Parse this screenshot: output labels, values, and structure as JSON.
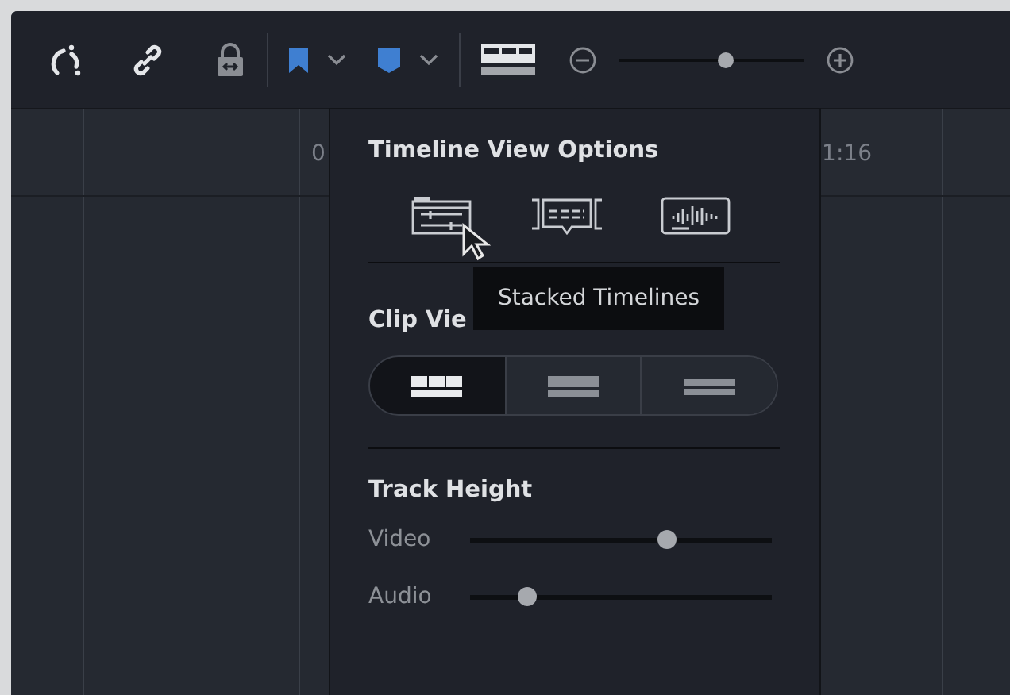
{
  "toolbar": {
    "zoom": {
      "level": 0.58
    }
  },
  "ruler": {
    "timecodes": [
      "0",
      "1:16"
    ]
  },
  "popover": {
    "timeline_view": {
      "title": "Timeline View Options"
    },
    "clip_view": {
      "title": "Clip Vie",
      "options": [
        {
          "selected": true
        },
        {
          "selected": false
        },
        {
          "selected": false
        }
      ]
    },
    "track_height": {
      "title": "Track Height",
      "sliders": [
        {
          "label": "Video",
          "level": 0.65
        },
        {
          "label": "Audio",
          "level": 0.19
        }
      ]
    }
  },
  "tooltip": {
    "text": "Stacked Timelines"
  }
}
